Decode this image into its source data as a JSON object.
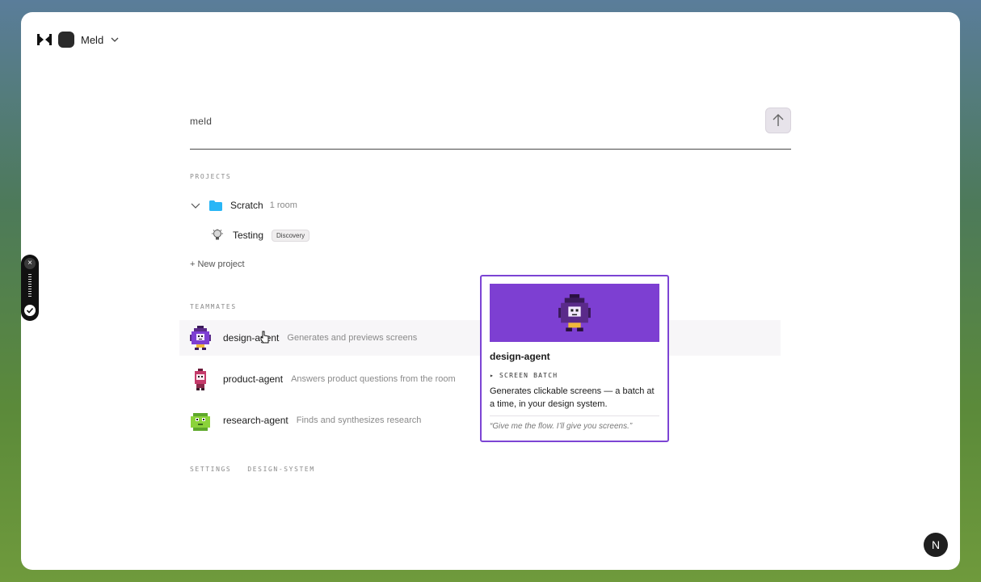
{
  "header": {
    "workspace_name": "Meld"
  },
  "prompt": {
    "text": "meld"
  },
  "projects": {
    "title": "PROJECTS",
    "items": [
      {
        "name": "Scratch",
        "meta": "1 room",
        "rooms": [
          {
            "name": "Testing",
            "badge": "Discovery"
          }
        ]
      }
    ],
    "new_label": "+ New project"
  },
  "teammates": {
    "title": "TEAMMATES",
    "items": [
      {
        "name": "design-agent",
        "desc": "Generates and previews screens"
      },
      {
        "name": "product-agent",
        "desc": "Answers product questions from the room"
      },
      {
        "name": "research-agent",
        "desc": "Finds and synthesizes research"
      }
    ]
  },
  "links": {
    "settings": "SETTINGS",
    "design_system": "DESIGN-SYSTEM"
  },
  "hover_card": {
    "title": "design-agent",
    "skill": "▸ SCREEN BATCH",
    "desc": "Generates clickable screens — a batch at a time, in your design system.",
    "quote": "“Give me the flow. I’ll give you screens.”"
  },
  "help": {
    "label": "N"
  },
  "colors": {
    "accent": "#7c44d4",
    "folder": "#29b6f6"
  }
}
